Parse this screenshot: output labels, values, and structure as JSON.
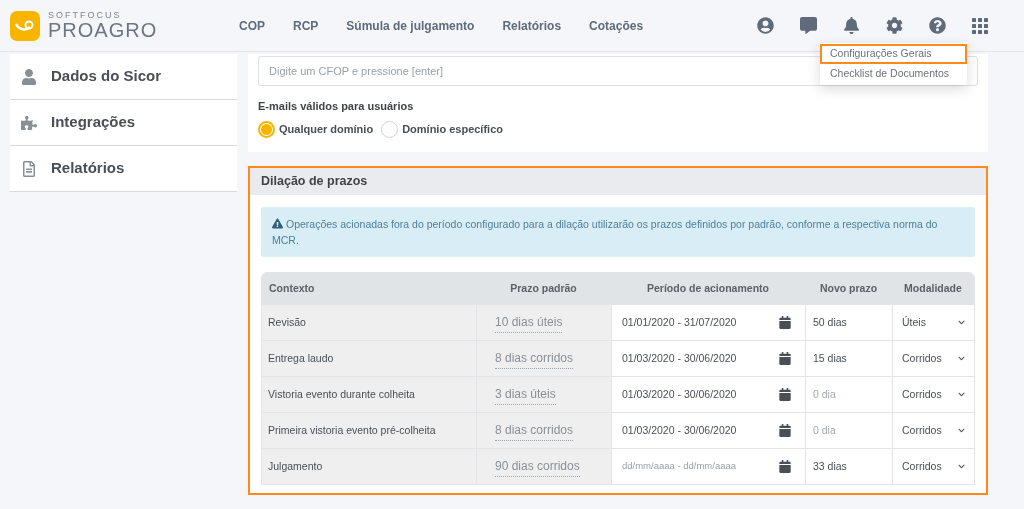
{
  "header": {
    "logo_top": "SOFTFOCUS",
    "logo_main": "PROAGRO",
    "nav": [
      {
        "label": "COP"
      },
      {
        "label": "RCP"
      },
      {
        "label": "Súmula de julgamento"
      },
      {
        "label": "Relatórios"
      },
      {
        "label": "Cotações"
      }
    ]
  },
  "settings_menu": {
    "items": [
      {
        "label": "Configurações Gerais",
        "highlighted": true
      },
      {
        "label": "Checklist de Documentos",
        "highlighted": false
      }
    ]
  },
  "sidebar": {
    "items": [
      {
        "label": "Dados do Sicor",
        "kind": "person"
      },
      {
        "label": "Integrações",
        "kind": "puzzle"
      },
      {
        "label": "Relatórios",
        "kind": "file"
      }
    ]
  },
  "general": {
    "cfop_placeholder": "Digite um CFOP e pressione [enter]",
    "emails_label": "E-mails válidos para usuários",
    "email_options": [
      {
        "label": "Qualquer domínio",
        "selected": true
      },
      {
        "label": "Domínio específico",
        "selected": false
      }
    ]
  },
  "dilacao": {
    "title": "Dilação de prazos",
    "notice": "Operações acionadas fora do período configurado para a dilação utilizarão os prazos definidos por padrão, conforme a respectiva norma do MCR.",
    "columns": [
      "Contexto",
      "Prazo padrão",
      "Período de acionamento",
      "Novo prazo",
      "Modalidade"
    ],
    "rows": [
      {
        "context": "Revisão",
        "default_term": "10 dias úteis",
        "period": "01/01/2020 - 31/07/2020",
        "new_term": "50 dias",
        "modality": "Úteis"
      },
      {
        "context": "Entrega laudo",
        "default_term": "8 dias corridos",
        "period": "01/03/2020 - 30/06/2020",
        "new_term": "15 dias",
        "modality": "Corridos"
      },
      {
        "context": "Vistoria evento durante colheita",
        "default_term": "3 dias úteis",
        "period": "01/03/2020 - 30/06/2020",
        "new_term_placeholder": "0 dia",
        "modality": "Corridos"
      },
      {
        "context": "Primeira vistoria evento pré-colheita",
        "default_term": "8 dias corridos",
        "period": "01/03/2020 - 30/06/2020",
        "new_term_placeholder": "0 dia",
        "modality": "Corridos"
      },
      {
        "context": "Julgamento",
        "default_term": "90 dias corridos",
        "period_placeholder": "dd/mm/aaaa - dd/mm/aaaa",
        "new_term": "33 dias",
        "modality": "Corridos"
      }
    ]
  }
}
